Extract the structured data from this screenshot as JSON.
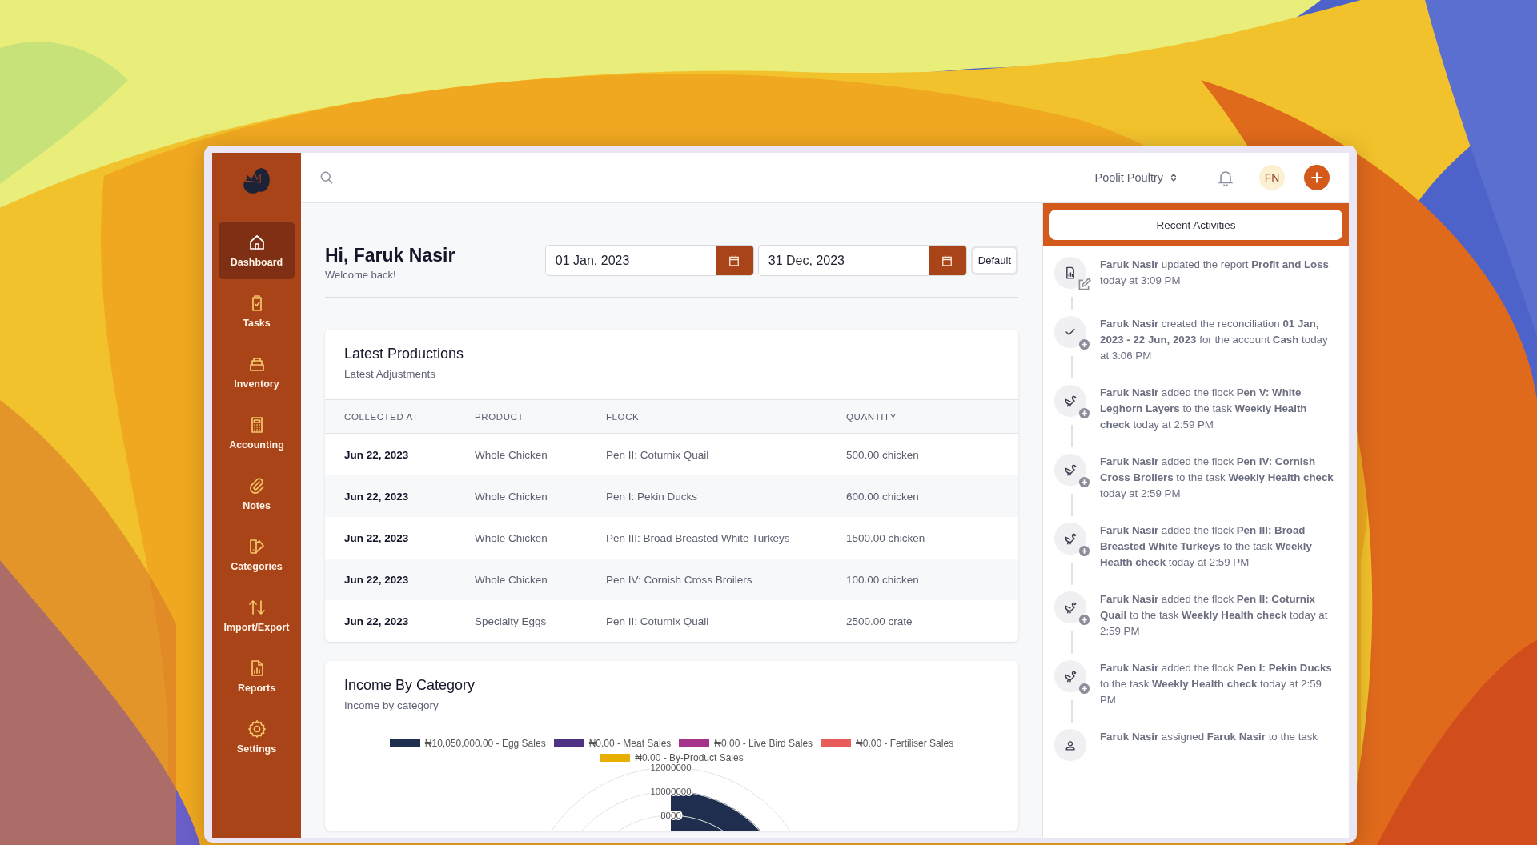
{
  "sidebar": {
    "items": [
      {
        "label": "Dashboard",
        "selected": true
      },
      {
        "label": "Tasks",
        "selected": false
      },
      {
        "label": "Inventory",
        "selected": false
      },
      {
        "label": "Accounting",
        "selected": false
      },
      {
        "label": "Notes",
        "selected": false
      },
      {
        "label": "Categories",
        "selected": false
      },
      {
        "label": "Import/Export",
        "selected": false
      },
      {
        "label": "Reports",
        "selected": false
      },
      {
        "label": "Settings",
        "selected": false
      }
    ]
  },
  "header": {
    "organization": "Poolit Poultry",
    "avatar": "FN"
  },
  "greeting": {
    "title": "Hi, Faruk Nasir",
    "subtitle": "Welcome back!"
  },
  "date_range": {
    "start": "01 Jan, 2023",
    "end": "31 Dec, 2023",
    "default_button": "Default"
  },
  "productions": {
    "title": "Latest Productions",
    "subtitle": "Latest Adjustments",
    "columns": [
      "COLLECTED AT",
      "PRODUCT",
      "FLOCK",
      "QUANTITY"
    ],
    "rows": [
      [
        "Jun 22, 2023",
        "Whole Chicken",
        "Pen II: Coturnix Quail",
        "500.00 chicken"
      ],
      [
        "Jun 22, 2023",
        "Whole Chicken",
        "Pen I: Pekin Ducks",
        "600.00 chicken"
      ],
      [
        "Jun 22, 2023",
        "Whole Chicken",
        "Pen III: Broad Breasted White Turkeys",
        "1500.00 chicken"
      ],
      [
        "Jun 22, 2023",
        "Whole Chicken",
        "Pen IV: Cornish Cross Broilers",
        "100.00 chicken"
      ],
      [
        "Jun 22, 2023",
        "Specialty Eggs",
        "Pen II: Coturnix Quail",
        "2500.00 crate"
      ]
    ]
  },
  "income": {
    "title": "Income By Category",
    "subtitle": "Income by category",
    "legend": [
      {
        "label": "₦10,050,000.00 - Egg Sales",
        "color": "#1f2d4e"
      },
      {
        "label": "₦0.00 - Meat Sales",
        "color": "#4e3385"
      },
      {
        "label": "₦0.00 - Live Bird Sales",
        "color": "#a6338a"
      },
      {
        "label": "₦0.00 - Fertiliser Sales",
        "color": "#e85d5a"
      },
      {
        "label": "₦0.00 - By-Product Sales",
        "color": "#e8ae00"
      }
    ],
    "scale_labels": [
      "12000000",
      "10000000",
      "8000"
    ]
  },
  "activities": {
    "title": "Recent Activities",
    "items": [
      {
        "kind": "report",
        "text": "**Faruk Nasir** updated the report **Profit and Loss** today at 3:09 PM"
      },
      {
        "kind": "reconciliation",
        "text": "**Faruk Nasir** created the reconciliation **01 Jan, 2023 - 22 Jun, 2023** for the account **Cash** today at 3:06 PM"
      },
      {
        "kind": "flock",
        "text": "**Faruk Nasir** added the flock **Pen V: White Leghorn Layers** to the task **Weekly Health check** today at 2:59 PM"
      },
      {
        "kind": "flock",
        "text": "**Faruk Nasir** added the flock **Pen IV: Cornish Cross Broilers** to the task **Weekly Health check** today at 2:59 PM"
      },
      {
        "kind": "flock",
        "text": "**Faruk Nasir** added the flock **Pen III: Broad Breasted White Turkeys** to the task **Weekly Health check** today at 2:59 PM"
      },
      {
        "kind": "flock",
        "text": "**Faruk Nasir** added the flock **Pen II: Coturnix Quail** to the task **Weekly Health check** today at 2:59 PM"
      },
      {
        "kind": "flock",
        "text": "**Faruk Nasir** added the flock **Pen I: Pekin Ducks** to the task **Weekly Health check** today at 2:59 PM"
      },
      {
        "kind": "assignment",
        "text": "**Faruk Nasir** assigned **Faruk Nasir** to the task"
      }
    ]
  }
}
